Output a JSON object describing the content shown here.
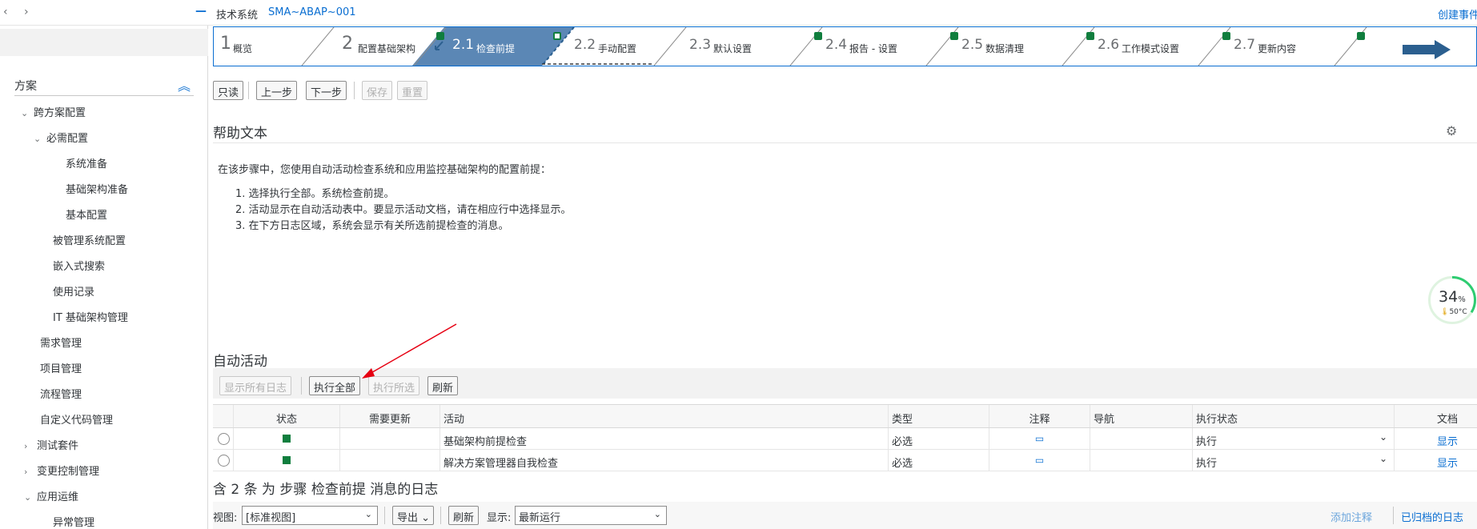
{
  "topbar": {
    "nav": "‹ ›",
    "minimize": "—",
    "system_label": "技术系统",
    "system_value": "SMA~ABAP~001",
    "create_event": "创建事件"
  },
  "sidebar": {
    "section": "方案",
    "items": [
      {
        "label": "跨方案配置",
        "chev": "⌄"
      },
      {
        "label": "必需配置",
        "chev": "⌄"
      },
      {
        "label": "系统准备",
        "chev": ""
      },
      {
        "label": "基础架构准备",
        "chev": ""
      },
      {
        "label": "基本配置",
        "chev": ""
      },
      {
        "label": "被管理系统配置",
        "chev": ""
      },
      {
        "label": "嵌入式搜索",
        "chev": ""
      },
      {
        "label": "使用记录",
        "chev": ""
      },
      {
        "label": "IT 基础架构管理",
        "chev": ""
      },
      {
        "label": "需求管理",
        "chev": ""
      },
      {
        "label": "项目管理",
        "chev": ""
      },
      {
        "label": "流程管理",
        "chev": ""
      },
      {
        "label": "自定义代码管理",
        "chev": ""
      },
      {
        "label": "测试套件",
        "chev": "›"
      },
      {
        "label": "变更控制管理",
        "chev": "›"
      },
      {
        "label": "应用运维",
        "chev": "⌄"
      },
      {
        "label": "异常管理",
        "chev": ""
      }
    ]
  },
  "steps": [
    {
      "num": "1",
      "label": "概览"
    },
    {
      "num": "2",
      "label": "配置基础架构"
    },
    {
      "num": "2.1",
      "label": "检查前提"
    },
    {
      "num": "2.2",
      "label": "手动配置"
    },
    {
      "num": "2.3",
      "label": "默认设置"
    },
    {
      "num": "2.4",
      "label": "报告 - 设置"
    },
    {
      "num": "2.5",
      "label": "数据清理"
    },
    {
      "num": "2.6",
      "label": "工作模式设置"
    },
    {
      "num": "2.7",
      "label": "更新内容"
    }
  ],
  "toolbar": {
    "readonly": "只读",
    "prev": "上一步",
    "next": "下一步",
    "save": "保存",
    "reset": "重置"
  },
  "help": {
    "title": "帮助文本",
    "intro": "在该步骤中，您使用自动活动检查系统和应用监控基础架构的配置前提：",
    "steps": [
      "1. 选择执行全部。系统检查前提。",
      "2. 活动显示在自动活动表中。要显示活动文档，请在相应行中选择显示。",
      "3. 在下方日志区域，系统会显示有关所选前提检查的消息。"
    ]
  },
  "gauge": {
    "percent": "34",
    "unit": "%",
    "temp": "50°C",
    "value": 0.34
  },
  "auto": {
    "title": "自动活动",
    "btn_show_logs": "显示所有日志",
    "btn_exec_all": "执行全部",
    "btn_exec_selected": "执行所选",
    "btn_refresh": "刷新",
    "headers": {
      "status": "状态",
      "needs_update": "需要更新",
      "activity": "活动",
      "type": "类型",
      "note": "注释",
      "nav": "导航",
      "exec_status": "执行状态",
      "doc": "文档"
    },
    "rows": [
      {
        "activity": "基础架构前提检查",
        "type": "必选",
        "exec_status": "执行",
        "doc": "显示"
      },
      {
        "activity": "解决方案管理器自我检查",
        "type": "必选",
        "exec_status": "执行",
        "doc": "显示"
      }
    ]
  },
  "log": {
    "title": "含 2 条 为 步骤 检查前提 消息的日志",
    "view_label": "视图:",
    "view_value": "[标准视图]",
    "export": "导出",
    "refresh": "刷新",
    "show_label": "显示:",
    "show_value": "最新运行",
    "add_note": "添加注释",
    "archived_log": "已归档的日志"
  },
  "colors": {
    "accent": "#0a6ed1",
    "active_step": "#5b87b5",
    "success": "#107e3e",
    "arrow": "#e60012"
  }
}
